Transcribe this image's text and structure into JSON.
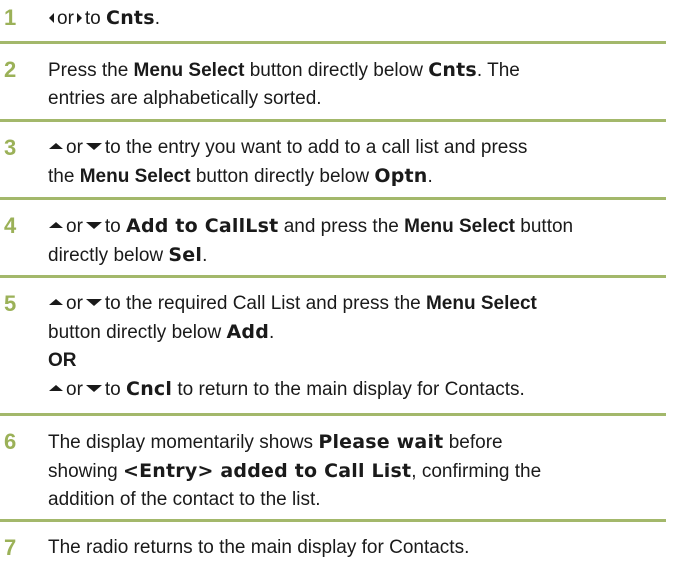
{
  "steps": [
    {
      "num": "1",
      "or": "or",
      "to": "to",
      "target": "Cnts",
      "end": "."
    },
    {
      "num": "2",
      "press": "Press the",
      "menu_select": "Menu Select",
      "btn_below": "button directly below",
      "target": "Cnts",
      "rest": ". The",
      "line2": "entries are alphabetically sorted."
    },
    {
      "num": "3",
      "or": "or",
      "line1_rest": "to the entry you want to add to a call list and press",
      "the": "the",
      "menu_select": "Menu Select",
      "btn_below": "button directly below",
      "target": "Optn",
      "end": "."
    },
    {
      "num": "4",
      "or": "or",
      "to": "to",
      "target": "Add to CallLst",
      "and_press": "and press the",
      "menu_select": "Menu Select",
      "button": "button",
      "line2": "directly below",
      "target2": "Sel",
      "end": "."
    },
    {
      "num": "5",
      "or": "or",
      "line1_rest": "to the required Call List and press the",
      "menu_select": "Menu Select",
      "line2": "button directly below",
      "target": "Add",
      "end": ".",
      "or_word": "OR",
      "or2": "or",
      "to2": "to",
      "target2": "Cncl",
      "line4_rest": "to return to the main display for Contacts."
    },
    {
      "num": "6",
      "line1_pre": "The display momentarily shows",
      "target": "Please wait",
      "line1_post": "before",
      "line2_pre": "showing",
      "target2": "<Entry> added to Call List",
      "line2_post": ", confirming the",
      "line3": "addition of the contact to the list."
    },
    {
      "num": "7",
      "text": "The radio returns to the main display for Contacts."
    }
  ]
}
